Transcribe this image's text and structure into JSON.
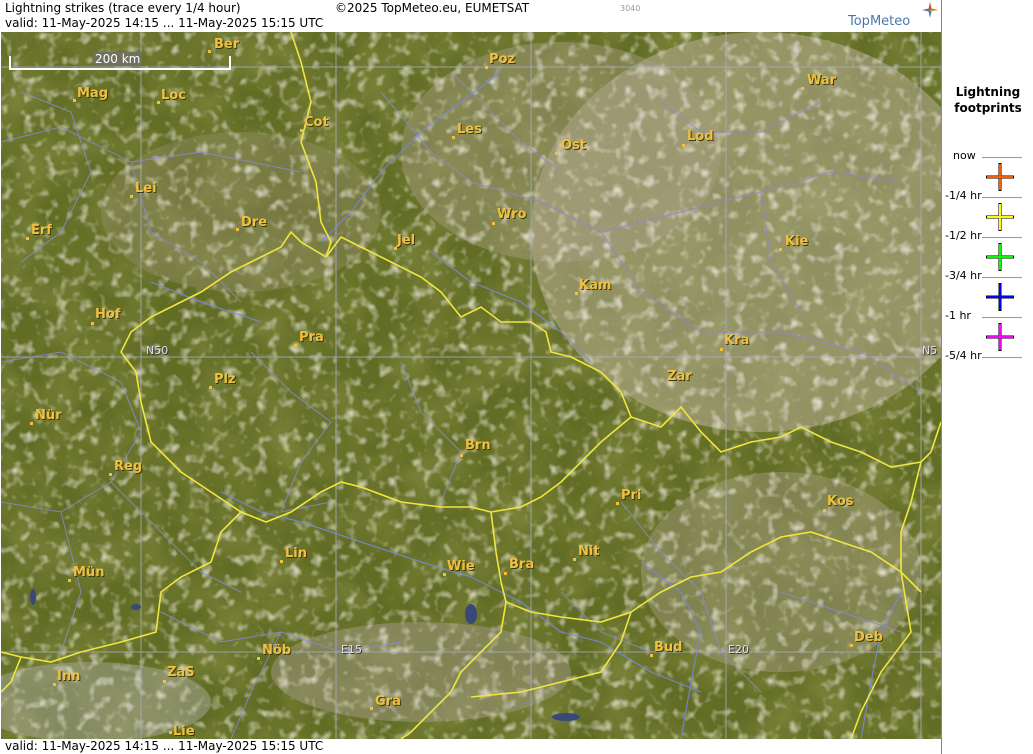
{
  "header": {
    "title": "Lightning strikes (trace every 1/4 hour)",
    "copyright": "©2025 TopMeteo.eu, EUMETSAT",
    "code": "3040",
    "valid": "valid:  11-May-2025 14:15 ... 11-May-2025 15:15 UTC",
    "logo": "TopMeteo"
  },
  "footer": {
    "valid": "valid:  11-May-2025 14:15 ... 11-May-2025 15:15 UTC"
  },
  "map": {
    "scale": "200 km",
    "grid_labels": {
      "n50_left": "N50",
      "n50_right": "N5",
      "e15": "E15",
      "e20": "E20"
    },
    "cities": [
      {
        "key": "ber",
        "name": "Ber"
      },
      {
        "key": "poz",
        "name": "Poz"
      },
      {
        "key": "war",
        "name": "War"
      },
      {
        "key": "mag",
        "name": "Mag"
      },
      {
        "key": "loc",
        "name": "Loc"
      },
      {
        "key": "cot",
        "name": "Cot"
      },
      {
        "key": "les",
        "name": "Les"
      },
      {
        "key": "ost",
        "name": "Ost"
      },
      {
        "key": "lod",
        "name": "Lod"
      },
      {
        "key": "lei",
        "name": "Lei"
      },
      {
        "key": "erf",
        "name": "Erf"
      },
      {
        "key": "dre",
        "name": "Dre"
      },
      {
        "key": "wro",
        "name": "Wro"
      },
      {
        "key": "jel",
        "name": "Jel"
      },
      {
        "key": "kie",
        "name": "Kie"
      },
      {
        "key": "kam",
        "name": "Kam"
      },
      {
        "key": "hof",
        "name": "Hof"
      },
      {
        "key": "pra",
        "name": "Pra"
      },
      {
        "key": "kra",
        "name": "Kra"
      },
      {
        "key": "plz",
        "name": "Plz"
      },
      {
        "key": "zar",
        "name": "Zar"
      },
      {
        "key": "nur",
        "name": "Nür"
      },
      {
        "key": "brn",
        "name": "Brn"
      },
      {
        "key": "reg",
        "name": "Reg"
      },
      {
        "key": "pri",
        "name": "Pri"
      },
      {
        "key": "kos",
        "name": "Kos"
      },
      {
        "key": "lin",
        "name": "Lin"
      },
      {
        "key": "nit",
        "name": "Nit"
      },
      {
        "key": "wie",
        "name": "Wie"
      },
      {
        "key": "bra",
        "name": "Bra"
      },
      {
        "key": "mun",
        "name": "Mün"
      },
      {
        "key": "deb",
        "name": "Deb"
      },
      {
        "key": "nob",
        "name": "Nöb"
      },
      {
        "key": "bud",
        "name": "Bud"
      },
      {
        "key": "inn",
        "name": "Inn"
      },
      {
        "key": "zas",
        "name": "ZaS"
      },
      {
        "key": "gra",
        "name": "Gra"
      },
      {
        "key": "lie",
        "name": "Lie"
      }
    ]
  },
  "legend": {
    "title_line1": "Lightning",
    "title_line2": "footprints",
    "items": [
      {
        "label": "now",
        "color": ""
      },
      {
        "label": "-1/4 hr",
        "color": "#ff5a00"
      },
      {
        "label": "-1/2 hr",
        "color": "#ffff00"
      },
      {
        "label": "-3/4 hr",
        "color": "#00ff00"
      },
      {
        "label": "-1 hr",
        "color": "#0000ff"
      },
      {
        "label": "-5/4 hr",
        "color": "#ff00ff"
      }
    ]
  }
}
